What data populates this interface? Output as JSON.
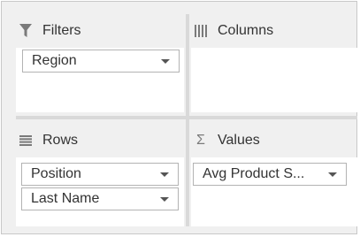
{
  "filters": {
    "title": "Filters",
    "icon": "funnel-icon",
    "fields": [
      {
        "label": "Region"
      }
    ]
  },
  "columns": {
    "title": "Columns",
    "icon": "columns-icon",
    "fields": []
  },
  "rows": {
    "title": "Rows",
    "icon": "rows-icon",
    "fields": [
      {
        "label": "Position"
      },
      {
        "label": "Last Name"
      }
    ]
  },
  "values": {
    "title": "Values",
    "icon": "sigma-icon",
    "icon_glyph": "Σ",
    "fields": [
      {
        "label": "Avg Product S..."
      }
    ]
  }
}
